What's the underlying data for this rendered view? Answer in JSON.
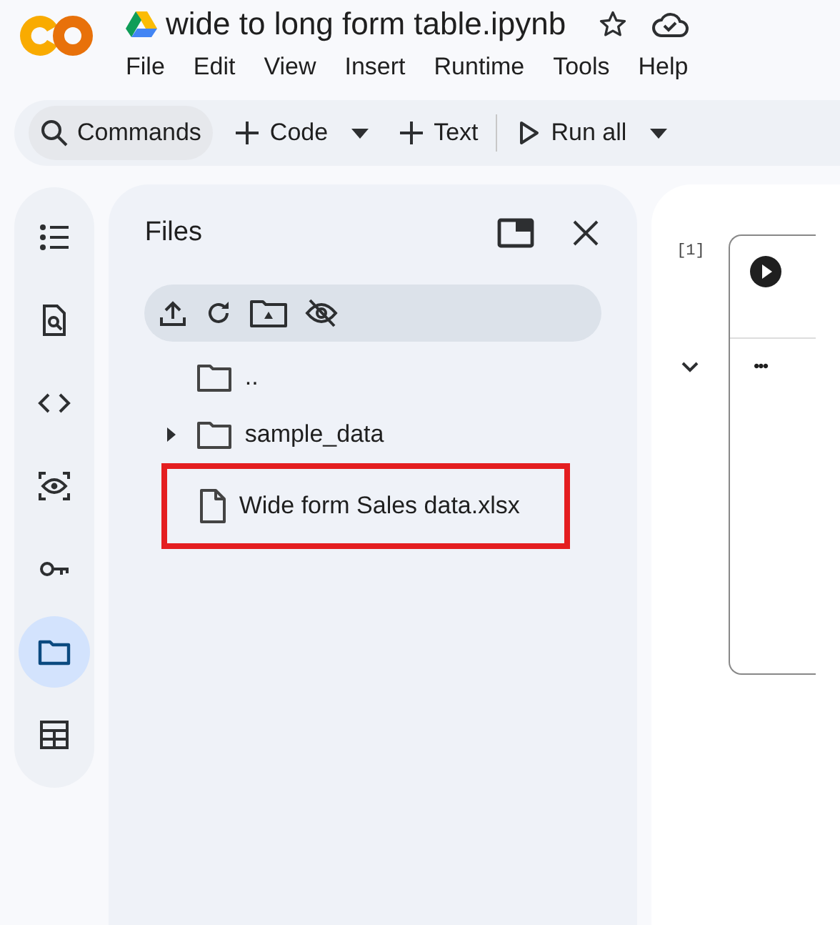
{
  "notebook": {
    "title": "wide to long form table.ipynb",
    "starred": false
  },
  "menu": [
    "File",
    "Edit",
    "View",
    "Insert",
    "Runtime",
    "Tools",
    "Help"
  ],
  "toolbar": [
    {
      "kind": "search",
      "label": "Commands"
    },
    {
      "kind": "add",
      "label": "Code",
      "dropdown": true
    },
    {
      "kind": "add",
      "label": "Text",
      "dropdown": false
    },
    {
      "kind": "run",
      "label": "Run all",
      "dropdown": true
    }
  ],
  "rail": [
    {
      "kind": "toc",
      "selected": false
    },
    {
      "kind": "find",
      "selected": false
    },
    {
      "kind": "code",
      "selected": false
    },
    {
      "kind": "vars",
      "selected": false
    },
    {
      "kind": "secrets",
      "selected": false
    },
    {
      "kind": "files",
      "selected": true
    },
    {
      "kind": "table",
      "selected": false
    }
  ],
  "files_panel": {
    "title": "Files",
    "items": [
      {
        "kind": "folder",
        "name": "..",
        "expandable": false,
        "highlighted": false
      },
      {
        "kind": "folder",
        "name": "sample_data",
        "expandable": true,
        "highlighted": false
      },
      {
        "kind": "file",
        "name": "Wide form Sales data.xlsx",
        "expandable": false,
        "highlighted": true
      }
    ]
  },
  "cell": {
    "execution_count": "[1]",
    "output_collapsed": false,
    "output": "•••"
  }
}
